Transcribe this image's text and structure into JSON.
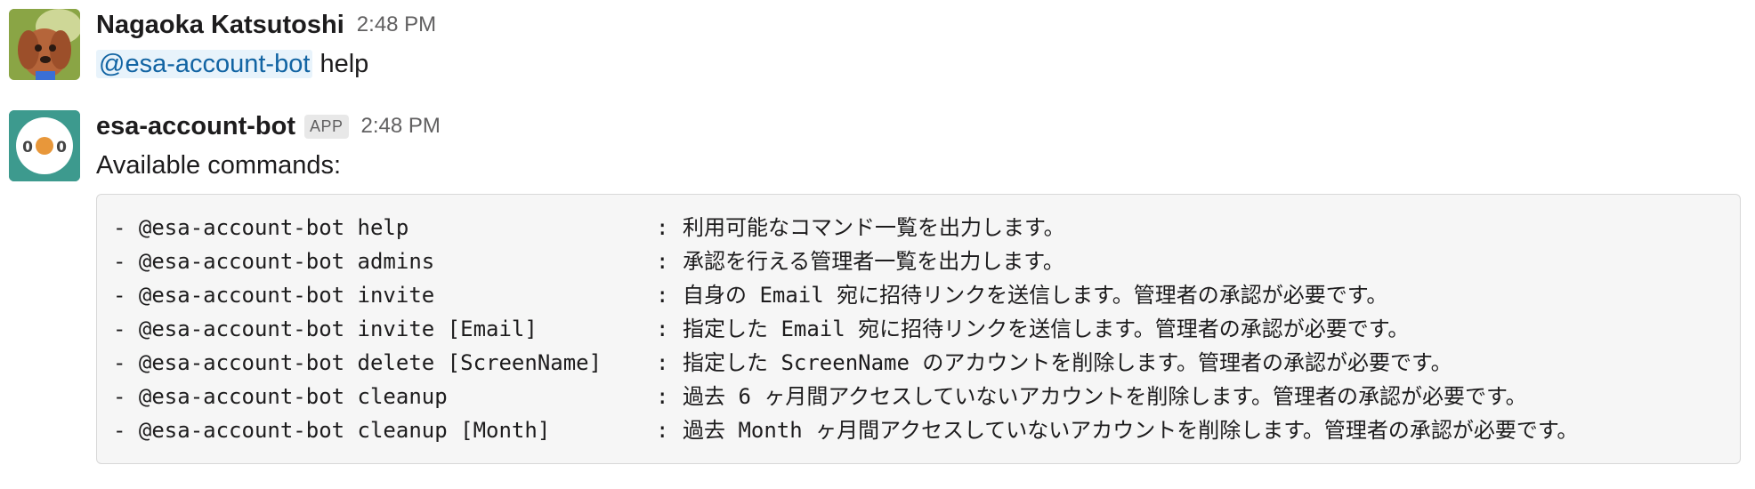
{
  "messages": [
    {
      "username": "Nagaoka Katsutoshi",
      "timestamp": "2:48 PM",
      "mention": "@esa-account-bot",
      "text": "help"
    },
    {
      "username": "esa-account-bot",
      "badge": "APP",
      "timestamp": "2:48 PM",
      "text": "Available commands:",
      "code_lines": [
        {
          "command": "- @esa-account-bot help",
          "separator": ":",
          "description": "利用可能なコマンド一覧を出力します。"
        },
        {
          "command": "- @esa-account-bot admins",
          "separator": ":",
          "description": "承認を行える管理者一覧を出力します。"
        },
        {
          "command": "- @esa-account-bot invite",
          "separator": ":",
          "description": "自身の Email 宛に招待リンクを送信します。管理者の承認が必要です。"
        },
        {
          "command": "- @esa-account-bot invite [Email]",
          "separator": ":",
          "description": "指定した Email 宛に招待リンクを送信します。管理者の承認が必要です。"
        },
        {
          "command": "- @esa-account-bot delete [ScreenName]",
          "separator": ":",
          "description": "指定した ScreenName のアカウントを削除します。管理者の承認が必要です。"
        },
        {
          "command": "- @esa-account-bot cleanup",
          "separator": ":",
          "description": "過去 6 ヶ月間アクセスしていないアカウントを削除します。管理者の承認が必要です。"
        },
        {
          "command": "- @esa-account-bot cleanup [Month]",
          "separator": ":",
          "description": "過去 Month ヶ月間アクセスしていないアカウントを削除します。管理者の承認が必要です。"
        }
      ]
    }
  ],
  "avatars": {
    "user": {
      "icon": "dog-photo-avatar",
      "background": "#91a84a"
    },
    "bot": {
      "icon": "esa-bot-logo",
      "background": "#3d9a8e",
      "accent": "#e8973a"
    }
  },
  "colors": {
    "mention_text": "#1264a3",
    "mention_bg": "#e8f3fb",
    "code_bg": "#f6f6f6"
  }
}
